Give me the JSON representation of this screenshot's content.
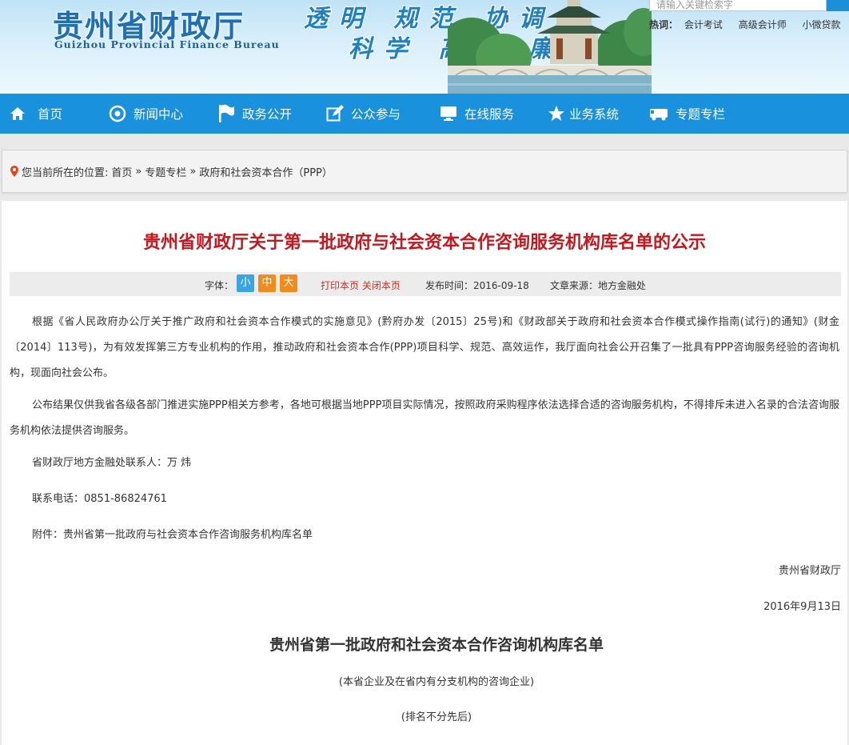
{
  "header": {
    "title_cn": "贵州省财政厅",
    "title_en": "Guizhou Provincial Finance Bureau",
    "slogan_line1": "透明 规范 协调",
    "slogan_line2": "科学 高效 廉洁",
    "search": {
      "placeholder": "请输入关键检索字"
    },
    "hot": {
      "label": "热词：",
      "words": [
        "会计考试",
        "高级会计师",
        "小微贷款"
      ]
    }
  },
  "nav": {
    "items": [
      {
        "label": "首页",
        "icon": "home-icon"
      },
      {
        "label": "新闻中心",
        "icon": "target-icon"
      },
      {
        "label": "政务公开",
        "icon": "flag-icon"
      },
      {
        "label": "公众参与",
        "icon": "edit-icon"
      },
      {
        "label": "在线服务",
        "icon": "monitor-icon"
      },
      {
        "label": "业务系统",
        "icon": "star-icon"
      },
      {
        "label": "专题专栏",
        "icon": "truck-icon"
      }
    ],
    "color": "#1a91dd"
  },
  "breadcrumb": {
    "prefix": "您当前所在的位置:",
    "items": [
      "首页",
      "专题专栏",
      "政府和社会资本合作（PPP）"
    ],
    "separator": "»"
  },
  "article": {
    "title": "贵州省财政厅关于第一批政府与社会资本合作咨询服务机构库名单的公示",
    "meta": {
      "font_label": "字体：",
      "font_sizes": [
        {
          "label": "小",
          "color": "#3aa5e0"
        },
        {
          "label": "中",
          "color": "#f08b1e"
        },
        {
          "label": "大",
          "color": "#f08b1e"
        }
      ],
      "print": "打印本页",
      "close": "关闭本页",
      "publish_time": "发布时间：2016-09-18",
      "source": "文章来源：地方金融处"
    },
    "paragraph1": "根据《省人民政府办公厅关于推广政府和社会资本合作模式的实施意见》(黔府办发〔2015〕25号)和《财政部关于政府和社会资本合作模式操作指南(试行)的通知》(财金〔2014〕113号)，为有效发挥第三方专业机构的作用，推动政府和社会资本合作(PPP)项目科学、规范、高效运作，我厅面向社会公开召集了一批具有PPP咨询服务经验的咨询机构，现面向社会公布。",
    "paragraph2": "公布结果仅供我省各级各部门推进实施PPP相关方参考，各地可根据当地PPP项目实际情况，按照政府采购程序依法选择合适的咨询服务机构，不得排斥未进入名录的合法咨询服务机构依法提供咨询服务。",
    "contact": "省财政厅地方金融处联系人：万  炜",
    "phone": "联系电话：0851-86824761",
    "attachment": "附件：贵州省第一批政府与社会资本合作咨询服务机构库名单",
    "signature": "贵州省财政厅",
    "date": "2016年9月13日",
    "list_title": "贵州省第一批政府和社会资本合作咨询机构库名单",
    "list_note1": "(本省企业及在省内有分支机构的咨询企业)",
    "list_note2": "(排名不分先后)",
    "title_color": "#c8161d"
  }
}
